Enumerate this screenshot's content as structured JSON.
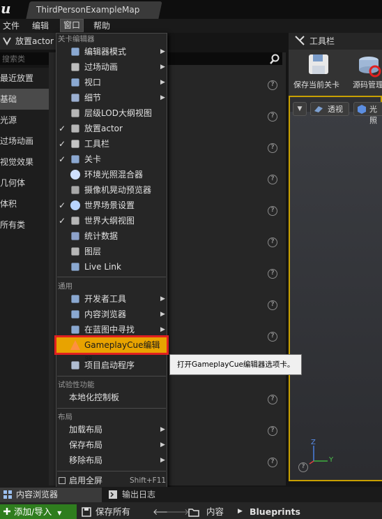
{
  "window": {
    "document_tab": "ThirdPersonExampleMap",
    "logo": "u"
  },
  "menubar": {
    "file": "文件",
    "edit": "编辑",
    "window": "窗口",
    "help": "帮助"
  },
  "left_panel": {
    "title": "放置actor",
    "search_placeholder": "搜索类",
    "categories": [
      "最近放置",
      "基础",
      "光源",
      "过场动画",
      "视觉效果",
      "几何体",
      "体积",
      "所有类"
    ]
  },
  "right_panel": {
    "tab_title": "工具栏",
    "save_label": "保存当前关卡",
    "source_label": "源码管理",
    "viewport_perspective": "透视",
    "viewport_lighting": "光照",
    "axis_z": "Z",
    "axis_y": "Y"
  },
  "dropdown": {
    "section_level_editor": "关卡编辑器",
    "items_level": [
      {
        "label": "编辑器模式",
        "check": false,
        "sub": true,
        "icon": "gear-icon"
      },
      {
        "label": "过场动画",
        "check": false,
        "sub": true,
        "icon": "clapper-icon"
      },
      {
        "label": "视口",
        "check": false,
        "sub": true,
        "icon": "viewport-icon"
      },
      {
        "label": "细节",
        "check": false,
        "sub": true,
        "icon": "details-icon"
      },
      {
        "label": "层级LOD大纲视图",
        "check": false,
        "sub": false,
        "icon": "layers-icon"
      },
      {
        "label": "放置actor",
        "check": true,
        "sub": false,
        "icon": "place-actor-icon"
      },
      {
        "label": "工具栏",
        "check": true,
        "sub": false,
        "icon": "tools-icon"
      },
      {
        "label": "关卡",
        "check": true,
        "sub": false,
        "icon": "level-icon"
      },
      {
        "label": "环境光照混合器",
        "check": false,
        "sub": false,
        "icon": "sphere-icon"
      },
      {
        "label": "摄像机晃动预览器",
        "check": false,
        "sub": false,
        "icon": "camera-shake-icon"
      },
      {
        "label": "世界场景设置",
        "check": true,
        "sub": false,
        "icon": "globe-icon"
      },
      {
        "label": "世界大纲视图",
        "check": true,
        "sub": false,
        "icon": "outliner-icon"
      },
      {
        "label": "统计数据",
        "check": false,
        "sub": false,
        "icon": "stats-icon"
      },
      {
        "label": "图层",
        "check": false,
        "sub": false,
        "icon": "layer-stack-icon"
      },
      {
        "label": "Live Link",
        "check": false,
        "sub": false,
        "icon": "live-link-icon"
      }
    ],
    "section_general": "通用",
    "items_general": [
      {
        "label": "开发者工具",
        "sub": true,
        "icon": "dev-tools-icon"
      },
      {
        "label": "内容浏览器",
        "sub": true,
        "icon": "content-browser-icon"
      },
      {
        "label": "在蓝图中寻找",
        "sub": true,
        "icon": "find-blueprint-icon"
      },
      {
        "label": "GameplayCue编辑器",
        "sub": false,
        "icon": "gameplaycue-icon"
      },
      {
        "label": "项目启动程序",
        "sub": false,
        "icon": "launcher-icon"
      }
    ],
    "section_experimental": "试验性功能",
    "item_localization": "本地化控制板",
    "section_layout": "布局",
    "items_layout": [
      "加载布局",
      "保存布局",
      "移除布局"
    ],
    "fullscreen_label": "启用全屏",
    "fullscreen_shortcut": "Shift+F11"
  },
  "tooltip": "打开GameplayCue编辑器选项卡。",
  "bottom": {
    "tab_content_browser": "内容浏览器",
    "tab_output_log": "输出日志",
    "add_import": "添加/导入",
    "save_all": "保存所有",
    "path_root": "内容",
    "path_leaf": "Blueprints"
  },
  "colors": {
    "highlight": "#e8a300",
    "annotation_box": "#e02020",
    "add_button": "#2f7d1e",
    "viewport_border": "#c8a000"
  }
}
